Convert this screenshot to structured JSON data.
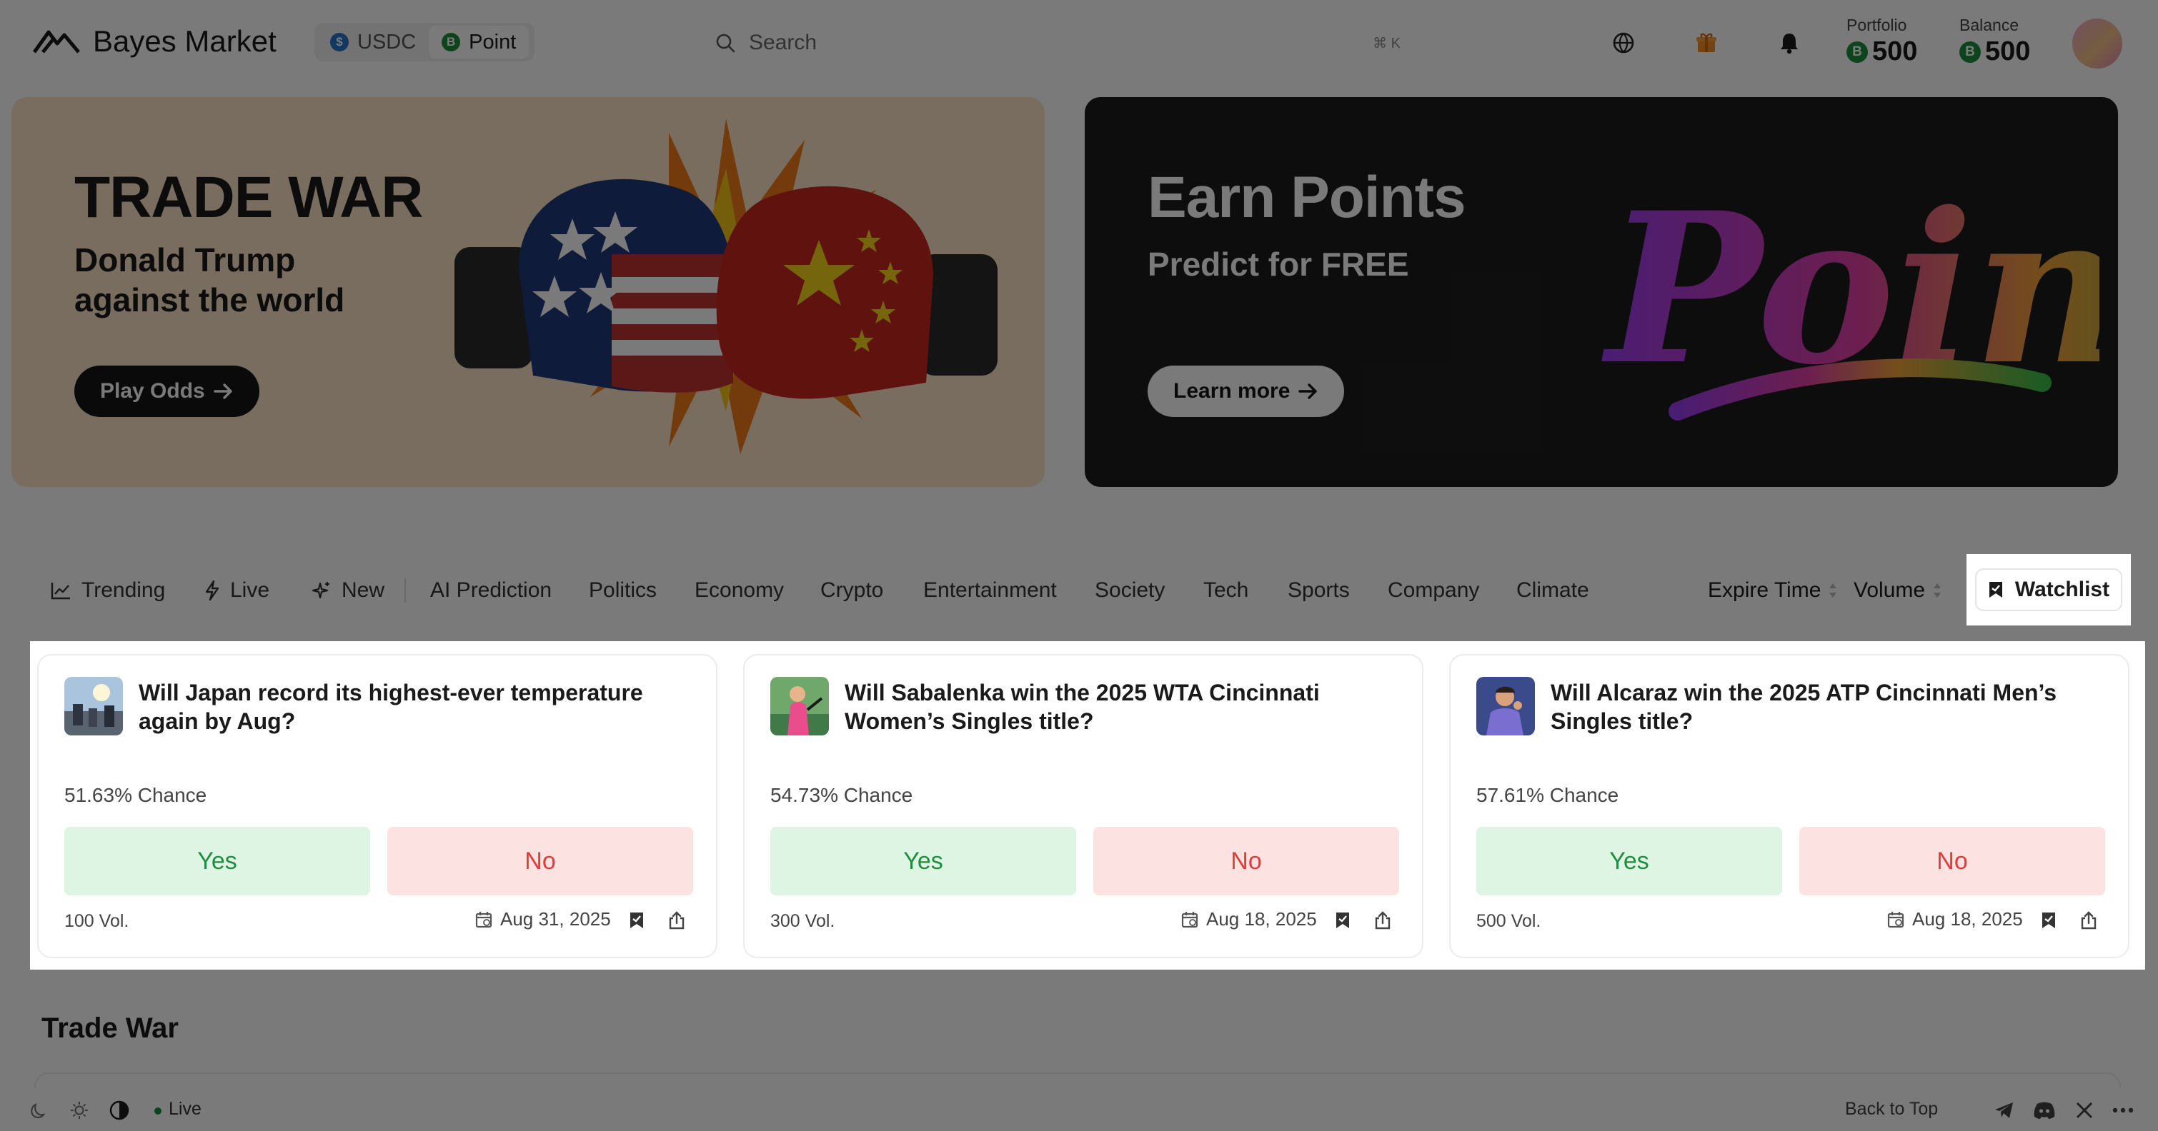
{
  "app": {
    "name": "Bayes Market",
    "currency_options": [
      "USDC",
      "Point"
    ],
    "active_currency": "Point"
  },
  "header": {
    "search_placeholder": "Search",
    "search_shortcut": "⌘ K",
    "portfolio_label": "Portfolio",
    "portfolio_value": "500",
    "balance_label": "Balance",
    "balance_value": "500",
    "icons": [
      "globe-icon",
      "gift-icon",
      "bell-icon"
    ]
  },
  "banners": [
    {
      "title": "TRADE WAR",
      "subtitle_line1": "Donald Trump",
      "subtitle_line2": "against the world",
      "button": "Play Odds",
      "background": "#fae3c5"
    },
    {
      "title": "Earn Points",
      "subtitle": "Predict for FREE",
      "button": "Learn more",
      "art_word": "Points",
      "background": "#1d1d1d"
    }
  ],
  "categories": {
    "tabs": [
      "Trending",
      "Live",
      "New",
      "AI Prediction",
      "Politics",
      "Economy",
      "Crypto",
      "Entertainment",
      "Society",
      "Tech",
      "Sports",
      "Company",
      "Climate"
    ],
    "sorts": [
      "Expire Time",
      "Volume"
    ],
    "watchlist_label": "Watchlist"
  },
  "markets": [
    {
      "question": "Will Japan record its highest-ever temperature again by Aug?",
      "chance": "51.63% Chance",
      "yes_label": "Yes",
      "no_label": "No",
      "volume": "100 Vol.",
      "date": "Aug 31, 2025"
    },
    {
      "question": "Will Sabalenka win the 2025 WTA Cincinnati Women’s Singles title?",
      "chance": "54.73% Chance",
      "yes_label": "Yes",
      "no_label": "No",
      "volume": "300 Vol.",
      "date": "Aug 18, 2025"
    },
    {
      "question": "Will Alcaraz win the 2025 ATP Cincinnati Men’s Singles title?",
      "chance": "57.61% Chance",
      "yes_label": "Yes",
      "no_label": "No",
      "volume": "500 Vol.",
      "date": "Aug 18, 2025"
    }
  ],
  "section": {
    "title": "Trade War"
  },
  "footer": {
    "status_label": "Live",
    "back_to_top": "Back to Top",
    "icons": [
      "moon-icon",
      "sun-icon",
      "contrast-icon",
      "telegram-icon",
      "discord-icon",
      "x-icon",
      "more-icon"
    ]
  },
  "colors": {
    "yes_text": "#1e8e3e",
    "yes_bg": "#dff5e3",
    "no_text": "#e23b3b",
    "no_bg": "#fde2e2",
    "point_coin": "#1e8e3e",
    "usdc_coin": "#2775ca"
  }
}
